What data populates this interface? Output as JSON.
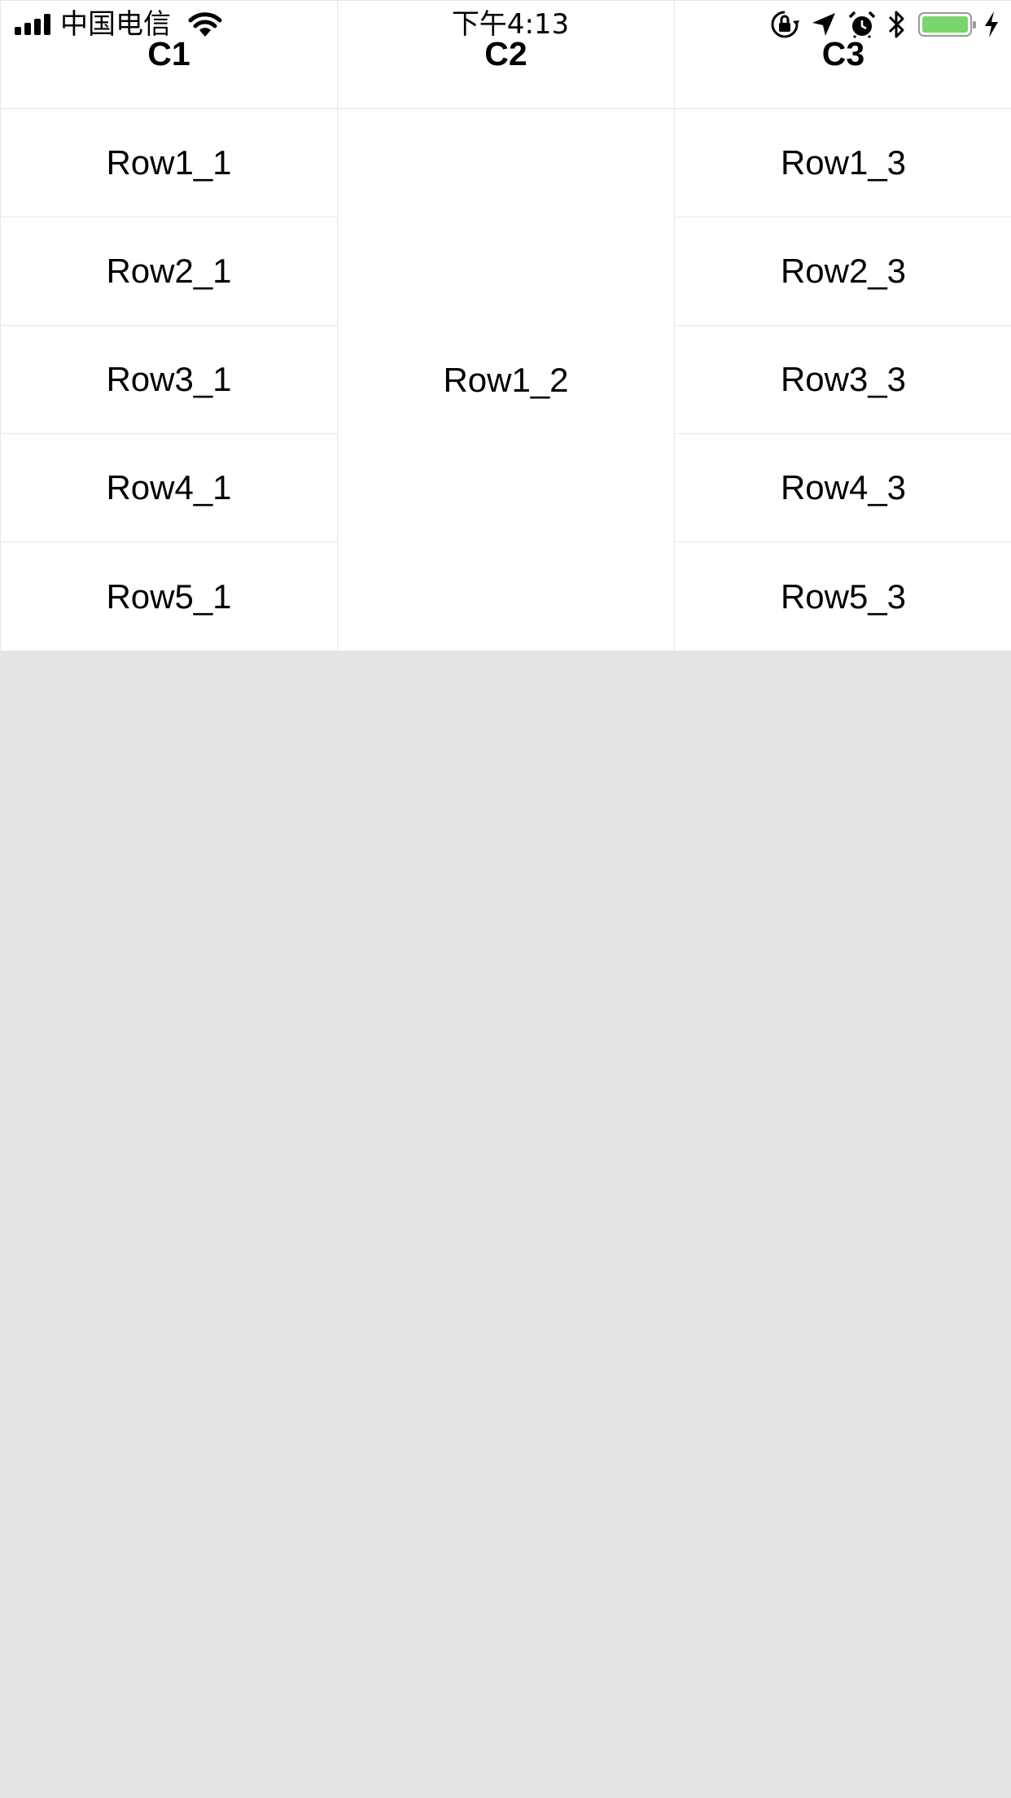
{
  "status_bar": {
    "carrier": "中国电信",
    "time": "下午4:13",
    "battery_level": 1.0,
    "icons": [
      "signal-icon",
      "wifi-icon",
      "orientation-lock-icon",
      "location-arrow-icon",
      "alarm-clock-icon",
      "bluetooth-icon",
      "battery-icon",
      "charging-bolt-icon"
    ]
  },
  "table": {
    "headers": [
      "C1",
      "C2",
      "C3"
    ],
    "col1": [
      "Row1_1",
      "Row2_1",
      "Row3_1",
      "Row4_1",
      "Row5_1"
    ],
    "col2_merged": "Row1_2",
    "col3": [
      "Row1_3",
      "Row2_3",
      "Row3_3",
      "Row4_3",
      "Row5_3"
    ]
  },
  "colors": {
    "background": "#e4e4e4",
    "table_background": "#ffffff",
    "grid_line": "#e6e6e6",
    "battery_fill": "#79d66f"
  }
}
